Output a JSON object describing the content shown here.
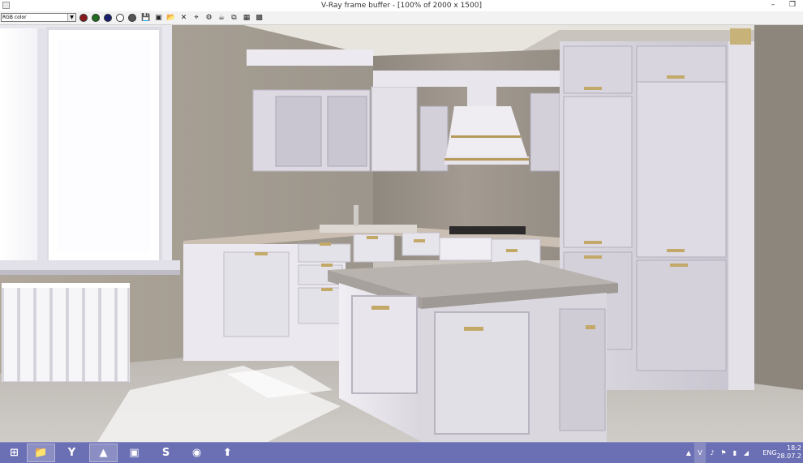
{
  "window": {
    "title": "V-Ray frame buffer - [100% of 2000 x 1500]",
    "minimize_label": "–",
    "restore_label": "❐"
  },
  "toolbar": {
    "channel_select": {
      "value": "RGB color"
    },
    "channel_dots": [
      {
        "name": "red-channel-button",
        "color": "#8a1a1a"
      },
      {
        "name": "green-channel-button",
        "color": "#1f6b1f"
      },
      {
        "name": "blue-channel-button",
        "color": "#1a1f70"
      },
      {
        "name": "alpha-channel-button",
        "color": "#ffffff"
      },
      {
        "name": "monochrome-button",
        "color": "#555555"
      }
    ],
    "tools": [
      {
        "name": "save-image-icon",
        "glyph": "💾"
      },
      {
        "name": "save-all-icon",
        "glyph": "▣"
      },
      {
        "name": "load-image-icon",
        "glyph": "📂"
      },
      {
        "name": "clear-image-icon",
        "glyph": "✕"
      },
      {
        "name": "track-mouse-icon",
        "glyph": "⌖"
      },
      {
        "name": "region-render-icon",
        "glyph": "⚙"
      },
      {
        "name": "render-last-icon",
        "glyph": "☕"
      },
      {
        "name": "link-to-vfb-icon",
        "glyph": "⧉"
      },
      {
        "name": "color-correction-icon",
        "glyph": "▦"
      },
      {
        "name": "lens-effects-icon",
        "glyph": "▩"
      }
    ]
  },
  "taskbar": {
    "apps": [
      {
        "name": "start-button",
        "glyph": "⊞",
        "active": false
      },
      {
        "name": "file-explorer-app",
        "glyph": "📁",
        "active": true
      },
      {
        "name": "yandex-browser-app",
        "glyph": "Y",
        "active": false
      },
      {
        "name": "3ds-max-app",
        "glyph": "▲",
        "active": true
      },
      {
        "name": "photo-viewer-app",
        "glyph": "▣",
        "active": false
      },
      {
        "name": "skype-app",
        "glyph": "S",
        "active": false
      },
      {
        "name": "media-app",
        "glyph": "◉",
        "active": false
      },
      {
        "name": "update-app",
        "glyph": "⬆",
        "active": false
      }
    ],
    "tray": {
      "language": "ENG",
      "time": "18:2",
      "date": "28.07.2"
    }
  },
  "colors": {
    "taskbar": "#6b6fb3",
    "wall": "#b8b0a4",
    "cabinet": "#e9e6ee",
    "countertop": "#cbbfb3",
    "floor": "#c8c4bf"
  }
}
